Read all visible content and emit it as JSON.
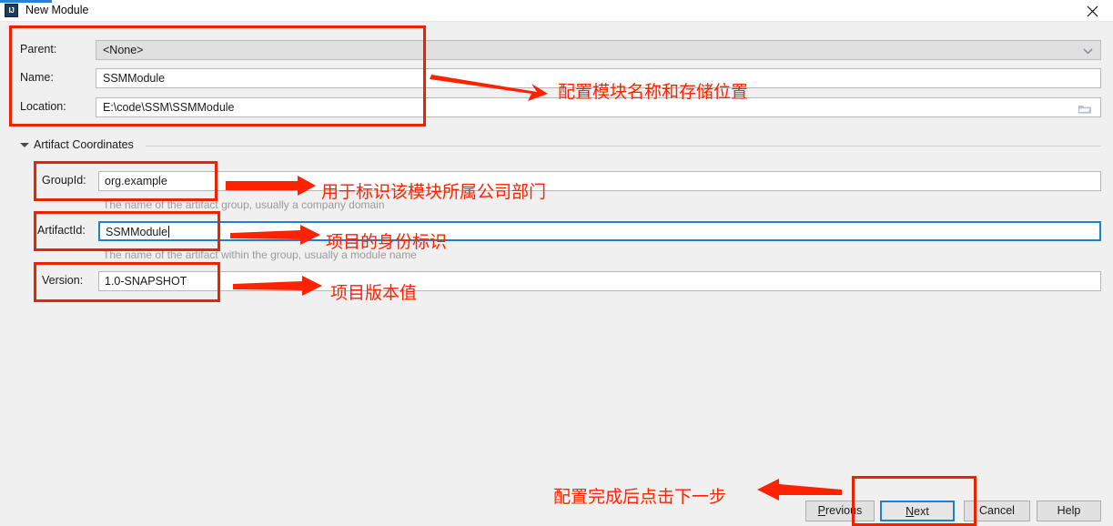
{
  "window": {
    "title": "New Module",
    "app_icon": "IJ",
    "close_icon": "close-icon"
  },
  "form": {
    "parent": {
      "label": "Parent:",
      "value": "<None>",
      "icon": "chevron-down-icon"
    },
    "name": {
      "label": "Name:",
      "value": "SSMModule"
    },
    "location": {
      "label": "Location:",
      "value": "E:\\code\\SSM\\SSMModule",
      "icon": "folder-icon"
    }
  },
  "artifact_section": {
    "title": "Artifact Coordinates",
    "collapse_icon": "triangle-down-icon",
    "group_id": {
      "label": "GroupId:",
      "value": "org.example",
      "hint": "The name of the artifact group, usually a company domain"
    },
    "artifact_id": {
      "label": "ArtifactId:",
      "value": "SSMModule",
      "hint": "The name of the artifact within the group, usually a module name"
    },
    "version": {
      "label": "Version:",
      "value": "1.0-SNAPSHOT"
    }
  },
  "buttons": {
    "previous": "Previous",
    "previous_mnemonic": "P",
    "next": "Next",
    "next_mnemonic": "N",
    "cancel": "Cancel",
    "help": "Help"
  },
  "annotations": {
    "a1": "配置模块名称和存储位置",
    "a2": "用于标识该模块所属公司部门",
    "a3": "项目的身份标识",
    "a4": "项目版本值",
    "a5": "配置完成后点击下一步"
  },
  "colors": {
    "annotation_red": "#ff2200",
    "focus_blue": "#1f7fd0",
    "background": "#f0f0f0"
  }
}
